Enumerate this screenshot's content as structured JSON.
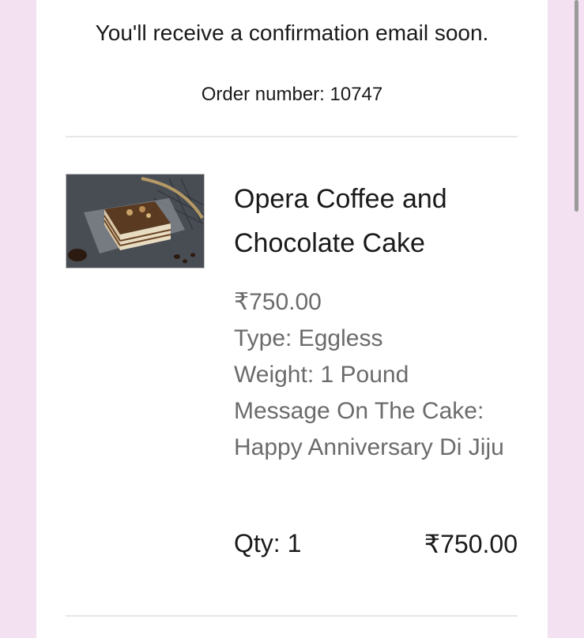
{
  "confirmation": {
    "message": "You'll receive a confirmation email soon."
  },
  "order": {
    "number_label": "Order number: 10747"
  },
  "item": {
    "image_icon": "cake-photo",
    "title": "Opera Coffee and Chocolate Cake",
    "price": "₹750.00",
    "type": "Type: Eggless",
    "weight": "Weight: 1 Pound",
    "message": "Message On The Cake: Happy Anniversary Di Jiju",
    "qty": "Qty: 1",
    "line_total": "₹750.00"
  },
  "colors": {
    "background": "#f3e0f1",
    "card": "#ffffff",
    "text_primary": "#1a1a1a",
    "text_secondary": "#6b6b6b",
    "divider": "#e6e6e6"
  }
}
